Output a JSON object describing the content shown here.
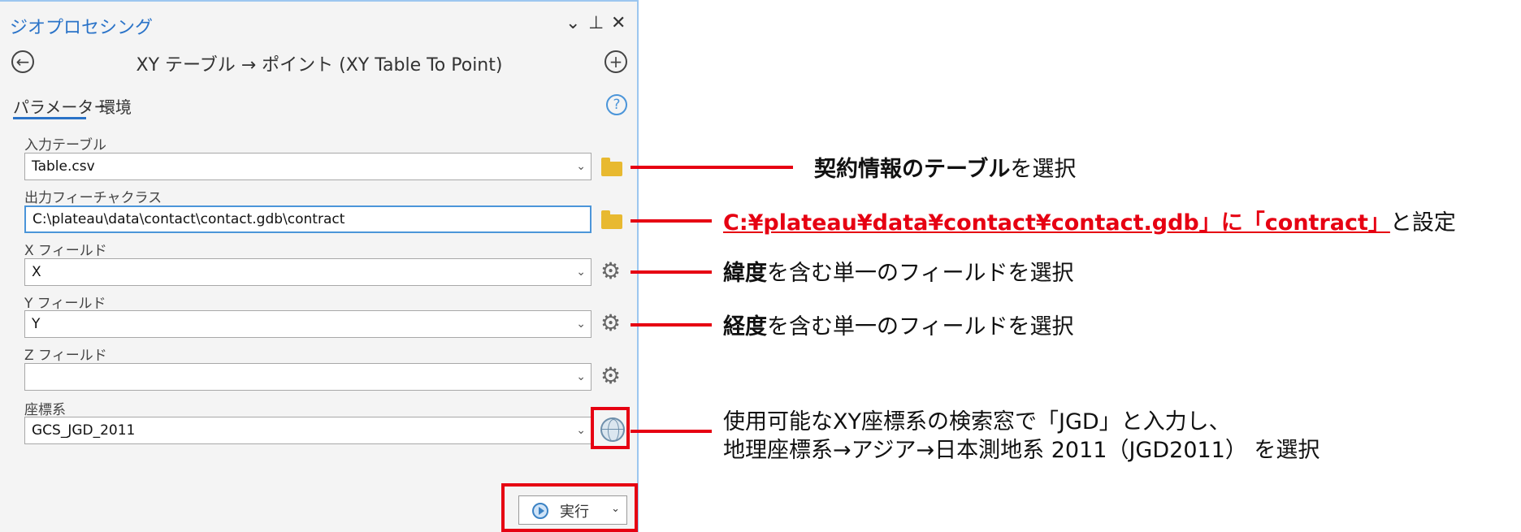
{
  "panel": {
    "title": "ジオプロセシング",
    "controls": {
      "dropdown": "⌄",
      "pin": "⊥",
      "close": "✕"
    },
    "back_glyph": "←",
    "tool_name": "XY テーブル → ポイント (XY Table To Point)",
    "add_glyph": "+",
    "tabs": [
      "パラメーター",
      "環境"
    ],
    "help_glyph": "?"
  },
  "fields": {
    "input_table": {
      "label": "入力テーブル",
      "value": "Table.csv"
    },
    "output_fc": {
      "label": "出力フィーチャクラス",
      "value": "C:\\plateau\\data\\contact\\contact.gdb\\contract"
    },
    "x_field": {
      "label": "X フィールド",
      "value": "X"
    },
    "y_field": {
      "label": "Y フィールド",
      "value": "Y"
    },
    "z_field": {
      "label": "Z フィールド",
      "value": ""
    },
    "coord_sys": {
      "label": "座標系",
      "value": "GCS_JGD_2011"
    }
  },
  "run_button": {
    "label": "実行"
  },
  "annotations": {
    "a1_bold": "契約情報のテーブル",
    "a1_rest": "を選択",
    "a2_red": "C:¥plateau¥data¥contact¥contact.gdb」に「contract」",
    "a2_rest": "と設定",
    "a3_bold": "緯度",
    "a3_rest": "を含む単一のフィールドを選択",
    "a4_bold": "経度",
    "a4_rest": "を含む単一のフィールドを選択",
    "a5_line1": "使用可能なXY座標系の検索窓で「JGD」と入力し、",
    "a5_line2": "地理座標系→アジア→日本測地系 2011（JGD2011） を選択"
  },
  "colors": {
    "accent": "#2a73c8",
    "annotation_red": "#e60012",
    "folder": "#e8b930"
  }
}
